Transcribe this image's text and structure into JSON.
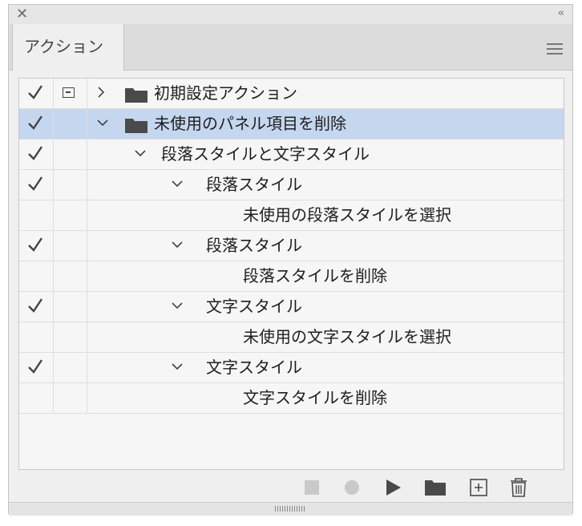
{
  "panel": {
    "tab_label": "アクション"
  },
  "rows": [
    {
      "label": "初期設定アクション",
      "checked": true,
      "dialog": true,
      "expand": "right",
      "folder": true
    },
    {
      "label": "未使用のパネル項目を削除",
      "checked": true,
      "dialog": false,
      "expand": "down",
      "folder": true
    },
    {
      "label": "段落スタイルと文字スタイル",
      "checked": true,
      "dialog": false,
      "expand": "down",
      "folder": false
    },
    {
      "label": "段落スタイル",
      "checked": true,
      "dialog": false,
      "expand": "down",
      "folder": false
    },
    {
      "label": "未使用の段落スタイルを選択",
      "checked": false,
      "dialog": false,
      "expand": "none",
      "folder": false
    },
    {
      "label": "段落スタイル",
      "checked": true,
      "dialog": false,
      "expand": "down",
      "folder": false
    },
    {
      "label": "段落スタイルを削除",
      "checked": false,
      "dialog": false,
      "expand": "none",
      "folder": false
    },
    {
      "label": "文字スタイル",
      "checked": true,
      "dialog": false,
      "expand": "down",
      "folder": false
    },
    {
      "label": "未使用の文字スタイルを選択",
      "checked": false,
      "dialog": false,
      "expand": "none",
      "folder": false
    },
    {
      "label": "文字スタイル",
      "checked": true,
      "dialog": false,
      "expand": "down",
      "folder": false
    },
    {
      "label": "文字スタイルを削除",
      "checked": false,
      "dialog": false,
      "expand": "none",
      "folder": false
    }
  ],
  "toolbar": {
    "buttons": [
      "stop-icon",
      "record-icon",
      "play-icon",
      "folder-icon",
      "new-action-icon",
      "trash-icon"
    ]
  }
}
